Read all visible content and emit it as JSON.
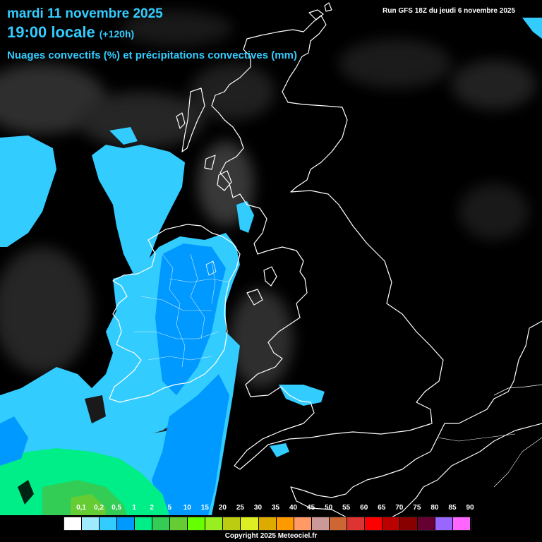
{
  "header": {
    "date": "mardi 11 novembre 2025",
    "time": "19:00 locale",
    "lead": "(+120h)",
    "parameter": "Nuages convectifs (%) et précipitations convectives (mm)",
    "run": "Run GFS 18Z du jeudi 6 novembre 2025"
  },
  "legend": {
    "labels": [
      "0,1",
      "0,2",
      "0,5",
      "1",
      "2",
      "5",
      "10",
      "15",
      "20",
      "25",
      "30",
      "35",
      "40",
      "45",
      "50",
      "55",
      "60",
      "65",
      "70",
      "75",
      "80",
      "85",
      "90"
    ],
    "colors": [
      "#ffffff",
      "#a0eaff",
      "#33ccff",
      "#0099ff",
      "#00ee88",
      "#33cc55",
      "#66cc33",
      "#66ff00",
      "#99ee22",
      "#bbcc11",
      "#ddee22",
      "#ddaa00",
      "#ff9900",
      "#ff9966",
      "#cc9999",
      "#cc6633",
      "#dd3333",
      "#ff0000",
      "#bb0000",
      "#880000",
      "#660033",
      "#9966ff",
      "#ff66ff"
    ]
  },
  "footer": {
    "copyright": "Copyright 2025 Meteociel.fr"
  },
  "colors": {
    "title_text": "#33ccff",
    "coastline": "#ffffff",
    "background": "#000000"
  }
}
